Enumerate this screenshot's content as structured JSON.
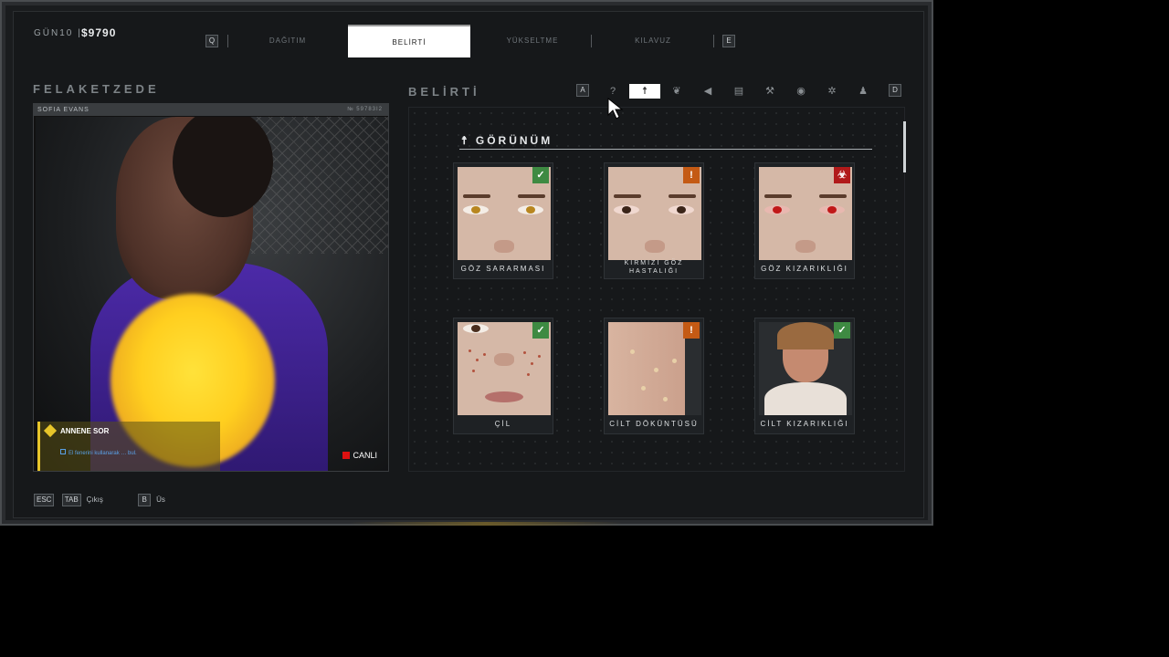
{
  "top": {
    "day_label": "GÜN10 |",
    "money": "$9790",
    "left_key": "Q",
    "right_key": "E",
    "tabs": [
      "DAĞITIM",
      "BELİRTİ",
      "YÜKSELTME",
      "KILAVUZ"
    ],
    "active_tab": "BELİRTİ"
  },
  "left": {
    "section_title": "FELAKETZEDE",
    "victim_name": "SOFIA EVANS",
    "victim_id": "№ 59783I2",
    "objective_title": "ANNENE SOR",
    "objective_text": "El fenerini kullanarak … bul.",
    "live_label": "CANLI"
  },
  "bottom_hints": {
    "esc_key": "ESC",
    "exit_key": "TAB",
    "exit_label": "Çıkış",
    "base_key": "B",
    "base_label": "Üs"
  },
  "right": {
    "section_title": "BELİRTİ",
    "left_key": "A",
    "right_key": "D",
    "category_icons": [
      "question-icon",
      "body-icon",
      "lungs-icon",
      "ear-icon",
      "stomach-icon",
      "hammer-icon",
      "eye-icon",
      "brain-icon",
      "person-icon"
    ],
    "active_category": "body-icon",
    "group_title": "GÖRÜNÜM",
    "cards": [
      {
        "label": "GÖZ SARARMASI",
        "badge": "safe"
      },
      {
        "label": "KIRMIZI GÖZ HASTALIĞI",
        "badge": "warning"
      },
      {
        "label": "GÖZ KIZARIKLIĞI",
        "badge": "biohazard"
      },
      {
        "label": "ÇİL",
        "badge": "safe"
      },
      {
        "label": "CİLT DÖKÜNTÜSÜ",
        "badge": "warning"
      },
      {
        "label": "CİLT KIZARIKLIĞI",
        "badge": "safe"
      }
    ]
  }
}
